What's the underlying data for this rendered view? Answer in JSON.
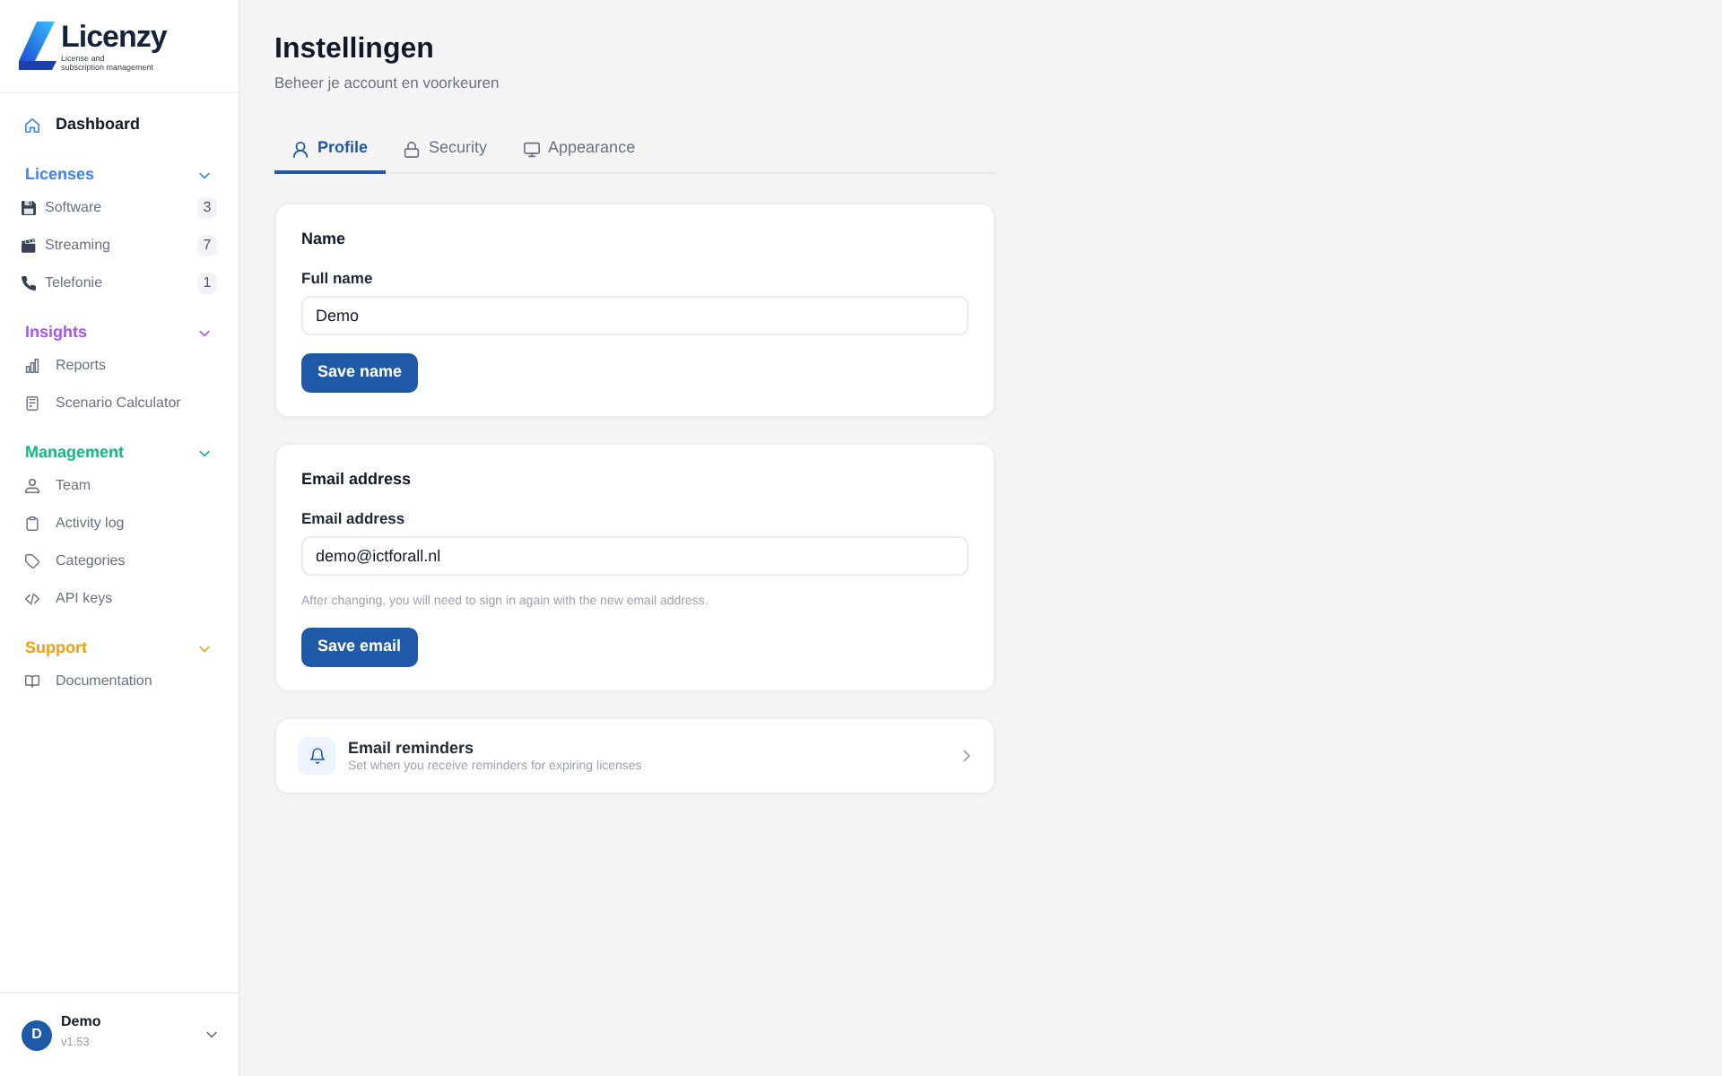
{
  "sidebar": {
    "brand": {
      "name": "Licenzy",
      "tagline": "License and\nsubscription management"
    },
    "home_link": {
      "label": "Dashboard"
    },
    "sections": [
      {
        "title": "Licenses",
        "color": "#3b82f6",
        "expanded": true,
        "items": [
          {
            "kind": "category",
            "label": "Software",
            "count": "3"
          },
          {
            "kind": "category",
            "label": "Streaming",
            "count": "7"
          },
          {
            "kind": "category",
            "label": "Telefonie",
            "count": "1"
          }
        ]
      },
      {
        "title": "Insights",
        "color": "#a855f7",
        "expanded": true,
        "items": [
          {
            "kind": "page",
            "label": "Reports"
          },
          {
            "kind": "page",
            "label": "Scenario Calculator"
          }
        ]
      },
      {
        "title": "Management",
        "color": "#10b981",
        "expanded": true,
        "items": [
          {
            "kind": "page",
            "label": "Team"
          },
          {
            "kind": "page",
            "label": "Activity log"
          },
          {
            "kind": "page",
            "label": "Categories"
          },
          {
            "kind": "page",
            "label": "API keys"
          }
        ]
      },
      {
        "title": "Support",
        "color": "#f59e0b",
        "expanded": true,
        "items": [
          {
            "kind": "page",
            "label": "Documentation"
          }
        ]
      }
    ],
    "user": {
      "initial": "D",
      "name": "Demo",
      "version": "v1.53"
    }
  },
  "header": {
    "title": "Instellingen",
    "subtitle": "Beheer je account en voorkeuren"
  },
  "tabs": [
    {
      "label": "Profile",
      "selected": true
    },
    {
      "label": "Security",
      "selected": false
    },
    {
      "label": "Appearance",
      "selected": false
    }
  ],
  "cards": [
    {
      "kind": "form",
      "title": "Name",
      "field": {
        "label": "Full name",
        "value": "Demo"
      },
      "button": "Save name"
    },
    {
      "kind": "form",
      "title": "Email address",
      "field": {
        "label": "Email address",
        "value": "demo@ictforall.nl"
      },
      "help": "After changing, you will need to sign in again with the new email address.",
      "button": "Save email"
    },
    {
      "kind": "link",
      "title": "Email reminders",
      "description": "Set when you receive reminders for expiring licenses"
    }
  ]
}
